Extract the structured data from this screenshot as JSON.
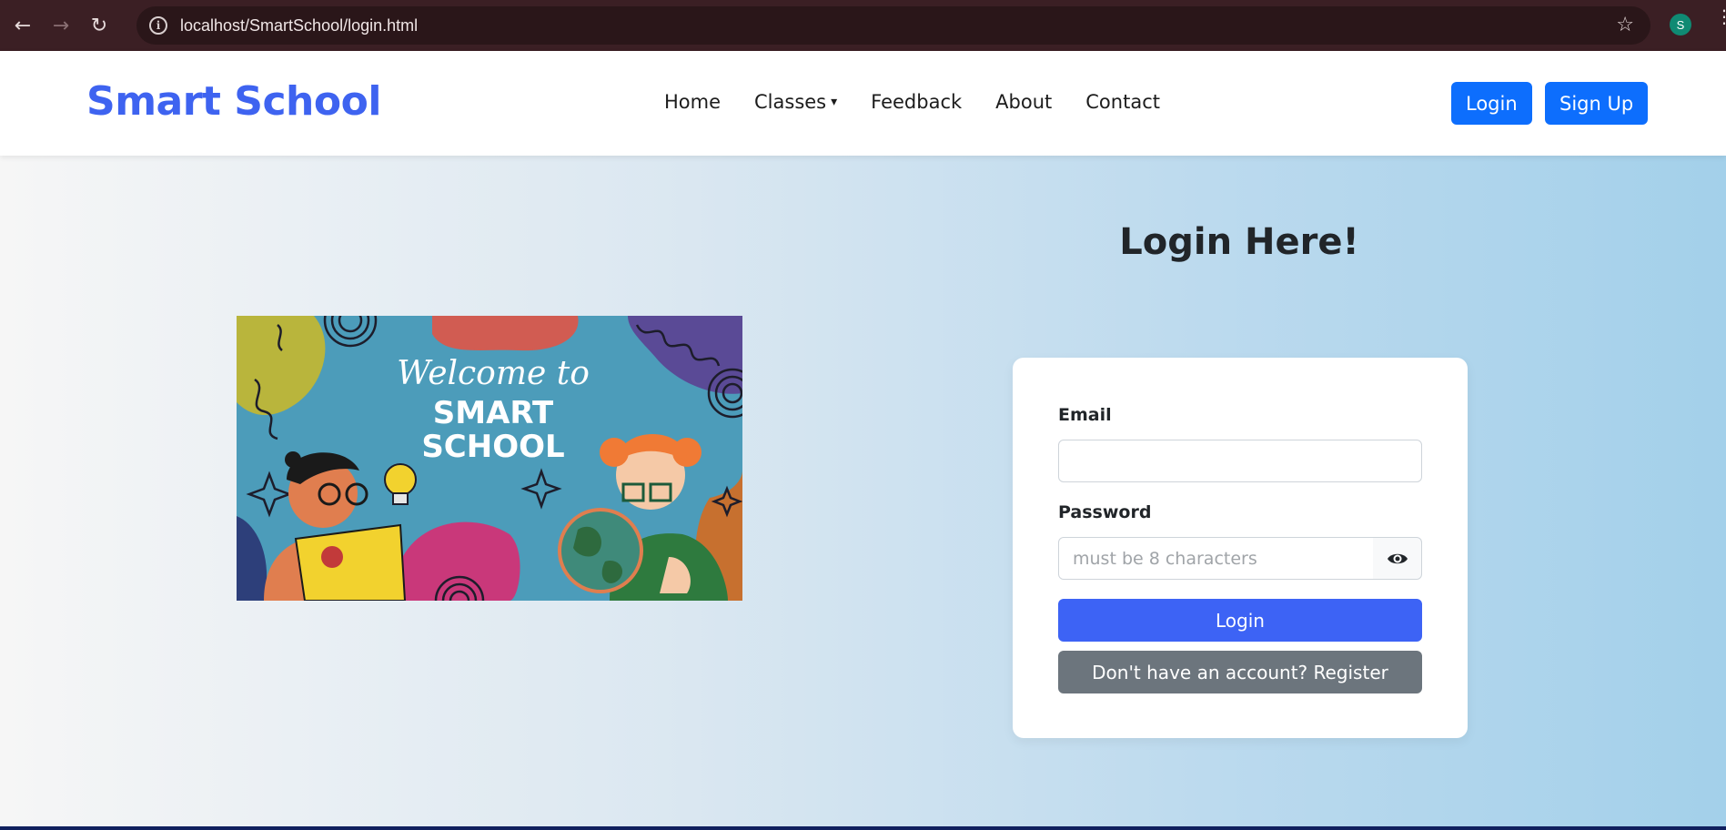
{
  "browser": {
    "url": "localhost/SmartSchool/login.html",
    "profile_initial": "S",
    "back_icon": "←",
    "forward_icon": "→",
    "reload_icon": "↻",
    "star_icon": "☆",
    "info_icon": "i",
    "kebab_icon": "⋮"
  },
  "navbar": {
    "brand": "Smart School",
    "menu": {
      "home": "Home",
      "classes": "Classes",
      "feedback": "Feedback",
      "about": "About",
      "contact": "Contact"
    },
    "caret_icon": "▾",
    "login_button": "Login",
    "signup_button": "Sign Up"
  },
  "hero": {
    "line1": "Welcome to",
    "line2": "SMART",
    "line3": "SCHOOL"
  },
  "login": {
    "heading": "Login Here!",
    "email_label": "Email",
    "email_value": "",
    "password_label": "Password",
    "password_placeholder": "must be 8 characters",
    "password_value": "",
    "submit_button": "Login",
    "register_button": "Don't have an account? Register"
  },
  "colors": {
    "brand": "#3e63f0",
    "nav_button": "#0d6efd",
    "primary_button": "#3d63f5",
    "secondary_button": "#6c757d",
    "browser_chrome": "#3b1f24"
  }
}
